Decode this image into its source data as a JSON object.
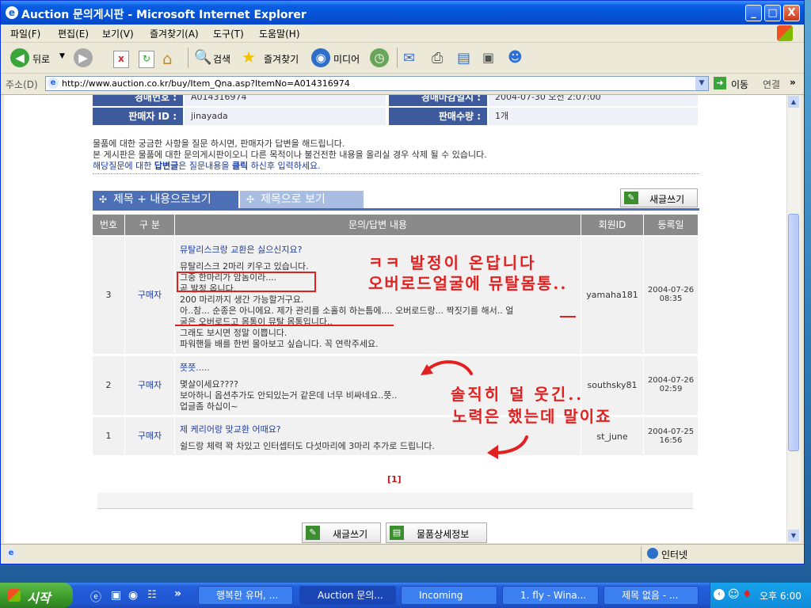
{
  "window": {
    "title": "Auction 문의게시판 - Microsoft Internet Explorer",
    "minimize": "_",
    "maximize": "□",
    "close": "X"
  },
  "menu": [
    "파일(F)",
    "편집(E)",
    "보기(V)",
    "즐겨찾기(A)",
    "도구(T)",
    "도움말(H)"
  ],
  "toolbar": {
    "back": "뒤로",
    "search": "검색",
    "favorites": "즐겨찾기",
    "media": "미디어"
  },
  "address": {
    "label": "주소(D)",
    "url": "http://www.auction.co.kr/buy/Item_Qna.asp?ItemNo=A014316974",
    "go": "이동",
    "links": "연결"
  },
  "info": {
    "item_no_label": "경매번호 :",
    "item_no": "A014316974",
    "deadline_label": "경매마감일시 :",
    "deadline": "2004-07-30 오전 2:07:00",
    "seller_label": "판매자 ID :",
    "seller": "jinayada",
    "qty_label": "판매수량 :",
    "qty": "1개"
  },
  "notice": {
    "line1": "물품에 대한 궁금한 사항을 질문 하시면, 판매자가 답변을 해드립니다.",
    "line2": "본 게시판은 물품에 대한 문의게시판이오니 다른 목적이나 불건전한 내용을 올리실 경우 삭제 될 수 있습니다.",
    "line3_a": "해당질문에 대한 ",
    "line3_b": "답변글",
    "line3_c": "은 질문내용을 ",
    "line3_d": "클릭",
    "line3_e": " 하신후 입력하세요."
  },
  "tabs": {
    "tab1": "제목 + 내용으로보기",
    "tab2": "제목으로 보기",
    "new_post": "새글쓰기"
  },
  "table": {
    "headers": [
      "번호",
      "구 분",
      "문의/답변 내용",
      "회원ID",
      "등록일"
    ],
    "rows": [
      {
        "no": "3",
        "type": "구매자",
        "title": "뮤탈리스크랑 교환은 싫으신지요?",
        "body": [
          "뮤탈리스크 2마리 키우고 있습니다.",
          "그중 한마리가 암놈이라....",
          "곧 발정 옵니다.",
          "200 마리까지 생간 가능할거구요.",
          "아..참... 순종은 아니에요. 제가 관리를 소홀히 하는틈에.... 오버로드랑... 짝짓기를 해서.. 얼",
          "굴은 오버로드고 몸통이 뮤탈 몸통입니다..",
          "그래도 보시면 정말 이쁩니다.",
          "파워핸들 배를 한번 몰아보고 싶습니다. 꼭 연락주세요."
        ],
        "member": "yamaha181",
        "date": "2004-07-26",
        "time": "08:35"
      },
      {
        "no": "2",
        "type": "구매자",
        "title": "쯧쯧.....",
        "body": [
          "몇살이세요????",
          "보아하니 옵션추가도 안되있는거 같은데 너무 비싸네요..쯧..",
          "업글좀 하십이~"
        ],
        "member": "southsky81",
        "date": "2004-07-26",
        "time": "02:59"
      },
      {
        "no": "1",
        "type": "구매자",
        "title": "제 케리어랑 맞교환 어때요?",
        "body": [
          "쉴드랑 체력 꽉 차있고 인터셉터도 다섯마리에 3마리 추가로 드립니다."
        ],
        "member": "st_june",
        "date": "2004-07-25",
        "time": "16:56"
      }
    ]
  },
  "annotations": {
    "a1_line1": "ㅋㅋ 발정이 온답니다",
    "a1_line2": "오버로드얼굴에 뮤탈몸통..",
    "a2_line1": "솔직히 덜 웃긴..",
    "a2_line2": "노력은 했는데 말이죠",
    "color": "#e1201f"
  },
  "pagination": "[1]",
  "bottom_buttons": {
    "new_post": "새글쓰기",
    "detail": "물품상세정보"
  },
  "status": {
    "zone": "인터넷"
  },
  "taskbar": {
    "start": "시작",
    "tasks": [
      "행복한 유머, ...",
      "Auction 문의...",
      "Incoming",
      "1. fly - Wina...",
      "제목 없음 - ..."
    ],
    "clock": "오후 6:00"
  }
}
